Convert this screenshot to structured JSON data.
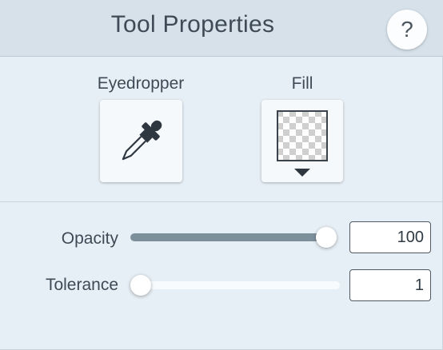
{
  "header": {
    "title": "Tool Properties",
    "help_label": "?"
  },
  "tools": {
    "eyedropper": {
      "label": "Eyedropper",
      "icon": "eyedropper-icon"
    },
    "fill": {
      "label": "Fill",
      "icon": "transparent-swatch-icon",
      "dropdown_icon": "caret-down-icon"
    }
  },
  "properties": {
    "opacity": {
      "label": "Opacity",
      "value": "100",
      "level": 1.0
    },
    "tolerance": {
      "label": "Tolerance",
      "value": "1",
      "level": 0.0
    }
  },
  "colors": {
    "header_bg": "#d6e1ea",
    "panel_bg": "#e7eff6",
    "slider_fill": "#7e8f9c",
    "text": "#3e4a55"
  }
}
